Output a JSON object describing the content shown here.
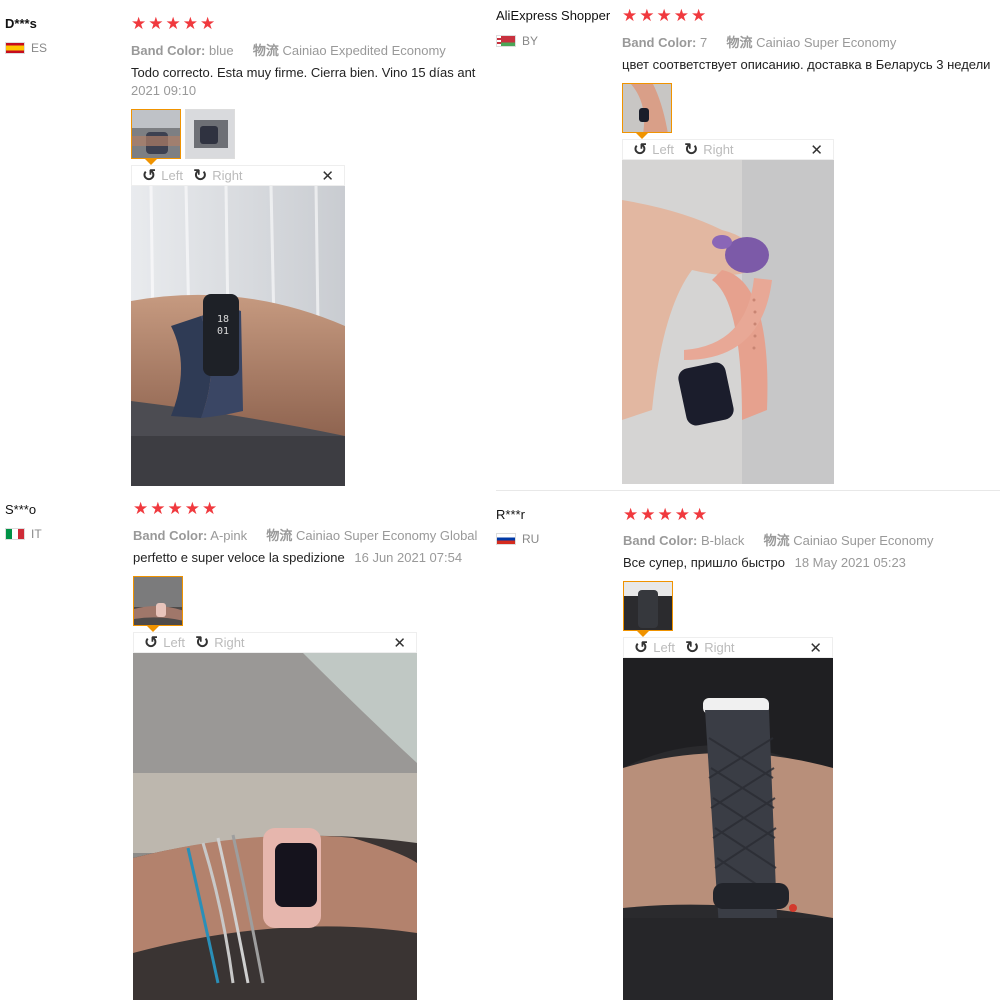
{
  "reviews": [
    {
      "user": "D***s",
      "country": "ES",
      "band_color_label": "Band Color:",
      "band_color": "blue",
      "shipping_label": "物流",
      "shipping": "Cainiao Expedited Economy",
      "text": "Todo correcto. Esta muy firme. Cierra bien. Vino 15 días ant",
      "date": "2021 09:10"
    },
    {
      "user": "AliExpress Shopper",
      "country": "BY",
      "band_color_label": "Band Color:",
      "band_color": "7",
      "shipping_label": "物流",
      "shipping": "Cainiao Super Economy",
      "text": "цвет соответствует описанию. доставка в Беларусь 3 недели"
    },
    {
      "user": "S***o",
      "country": "IT",
      "band_color_label": "Band Color:",
      "band_color": "A-pink",
      "shipping_label": "物流",
      "shipping": "Cainiao Super Economy Global",
      "text": "perfetto e super veloce la spedizione",
      "date": "16 Jun 2021 07:54"
    },
    {
      "user": "R***r",
      "country": "RU",
      "band_color_label": "Band Color:",
      "band_color": "B-black",
      "shipping_label": "物流",
      "shipping": "Cainiao Super Economy",
      "text": "Все супер, пришло быстро",
      "date": "18 May 2021 05:23"
    }
  ],
  "viewer": {
    "left_label": "Left",
    "right_label": "Right",
    "rotate_left_icon": "↺",
    "rotate_right_icon": "↻",
    "close_icon": "✕"
  },
  "stars_glyph": "★",
  "colors": {
    "star": "#f0393e",
    "active_thumb": "#f09300"
  }
}
